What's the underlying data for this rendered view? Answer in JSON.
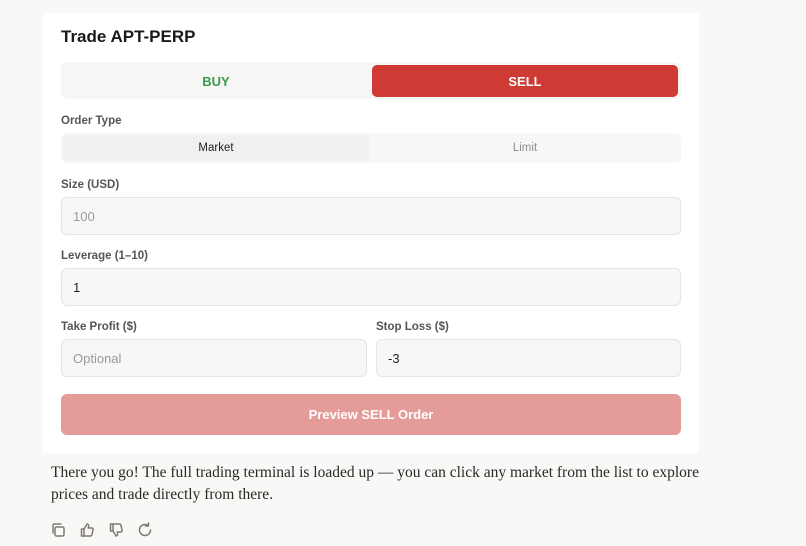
{
  "panel": {
    "title": "Trade APT-PERP",
    "side": {
      "buy_label": "BUY",
      "sell_label": "SELL",
      "selected": "SELL"
    },
    "order_type": {
      "label": "Order Type",
      "options": [
        "Market",
        "Limit"
      ],
      "selected": "Market"
    },
    "size": {
      "label": "Size (USD)",
      "value": "",
      "placeholder": "100"
    },
    "leverage": {
      "label": "Leverage (1–10)",
      "value": "1",
      "placeholder": ""
    },
    "take_profit": {
      "label": "Take Profit ($)",
      "value": "",
      "placeholder": "Optional"
    },
    "stop_loss": {
      "label": "Stop Loss ($)",
      "value": "-3",
      "placeholder": ""
    },
    "preview_label": "Preview SELL Order"
  },
  "message": {
    "text": "There you go! The full trading terminal is loaded up — you can click any market from the list to explore prices and trade directly from there."
  },
  "actions": [
    "copy-icon",
    "thumbs-up-icon",
    "thumbs-down-icon",
    "retry-icon"
  ],
  "colors": {
    "sell": "#cf3a35",
    "buy": "#3a9a4e",
    "preview": "#e59c98",
    "background": "#f9f8f6"
  }
}
